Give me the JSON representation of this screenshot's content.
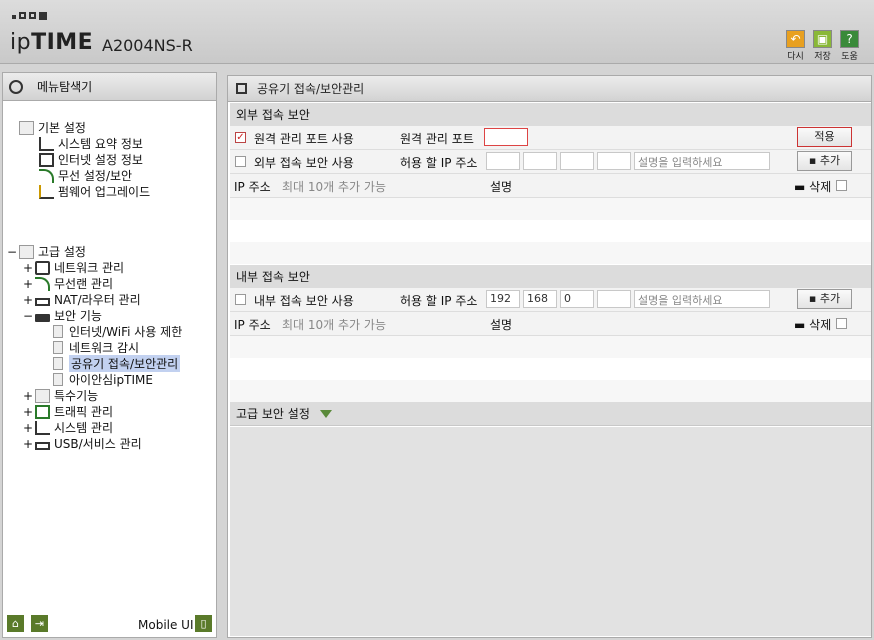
{
  "header": {
    "brand_prefix": "ip",
    "brand_bold": "TIME",
    "model": "A2004NS-R",
    "buttons": [
      {
        "label": "다시",
        "icon": "undo-icon",
        "color": "#e8a020"
      },
      {
        "label": "저장",
        "icon": "save-icon",
        "color": "#8ab838"
      },
      {
        "label": "도움",
        "icon": "help-icon",
        "color": "#3a8a3a"
      }
    ]
  },
  "sidebar": {
    "title": "메뉴탐색기",
    "basic": {
      "label": "기본 설정",
      "items": [
        "시스템 요약 정보",
        "인터넷 설정 정보",
        "무선 설정/보안",
        "펌웨어 업그레이드"
      ]
    },
    "advanced": {
      "toggle": "−",
      "label": "고급 설정",
      "groups": [
        {
          "toggle": "+",
          "label": "네트워크 관리"
        },
        {
          "toggle": "+",
          "label": "무선랜 관리"
        },
        {
          "toggle": "+",
          "label": "NAT/라우터 관리"
        },
        {
          "toggle": "−",
          "label": "보안 기능"
        }
      ],
      "security_items": [
        "인터넷/WiFi 사용 제한",
        "네트워크 감시",
        "공유기 접속/보안관리",
        "아이안심ipTIME"
      ],
      "more_groups": [
        {
          "toggle": "+",
          "label": "특수기능"
        },
        {
          "toggle": "+",
          "label": "트래픽 관리"
        },
        {
          "toggle": "+",
          "label": "시스템 관리"
        },
        {
          "toggle": "+",
          "label": "USB/서비스 관리"
        }
      ]
    },
    "footer": {
      "mobile_label": "Mobile UI"
    }
  },
  "main": {
    "title": "공유기 접속/보안관리",
    "external": {
      "section_title": "외부 접속 보안",
      "remote_checkbox_label": "원격 관리 포트 사용",
      "remote_checked": true,
      "remote_port_label": "원격 관리 포트",
      "remote_port_value": "",
      "apply_button": "적용",
      "ext_checkbox_label": "외부 접속 보안 사용",
      "ext_checked": false,
      "allow_ip_label": "허용 할 IP 주소",
      "ip": [
        "",
        "",
        "",
        ""
      ],
      "desc_placeholder": "설명을 입력하세요",
      "add_button": "추가",
      "list_ip_header": "IP 주소",
      "list_hint": "최대 10개 추가 가능",
      "list_desc_header": "설명",
      "delete_label": "삭제"
    },
    "internal": {
      "section_title": "내부 접속 보안",
      "int_checkbox_label": "내부 접속 보안 사용",
      "int_checked": false,
      "allow_ip_label": "허용 할 IP 주소",
      "ip": [
        "192",
        "168",
        "0",
        ""
      ],
      "desc_placeholder": "설명을 입력하세요",
      "add_button": "추가",
      "list_ip_header": "IP 주소",
      "list_hint": "최대 10개 추가 가능",
      "list_desc_header": "설명",
      "delete_label": "삭제"
    },
    "advanced_section_title": "고급 보안 설정"
  }
}
